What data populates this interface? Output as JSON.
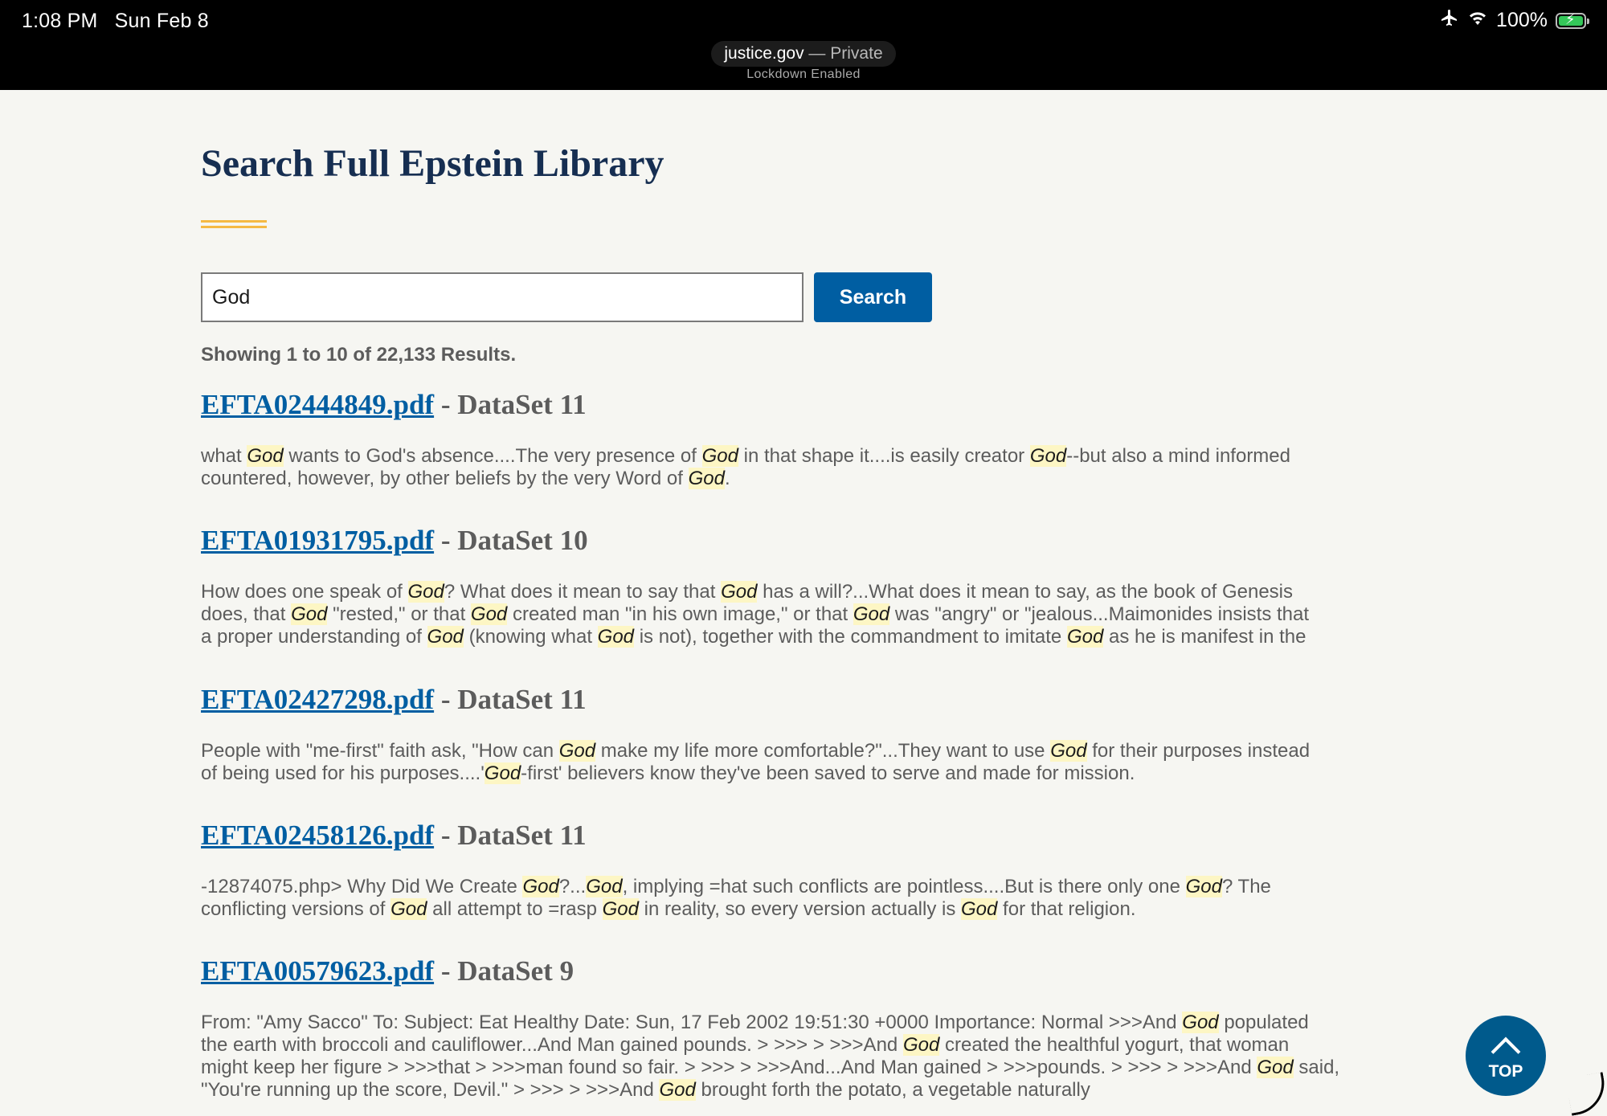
{
  "status_bar": {
    "time": "1:08 PM",
    "date": "Sun Feb 8",
    "battery": "100%",
    "url_domain": "justice.gov",
    "url_mode": " — Private",
    "lockdown": "Lockdown Enabled"
  },
  "page": {
    "title": "Search Full Epstein Library",
    "search_value": "God",
    "search_button": "Search",
    "results_count": "Showing 1 to 10 of 22,133 Results.",
    "top_button": "TOP"
  },
  "results": [
    {
      "file": "EFTA02444849.pdf",
      "dataset": " - DataSet 11",
      "lines": [
        [
          [
            "what ",
            false
          ],
          [
            "God",
            true
          ],
          [
            " wants to God's absence....The very presence of ",
            false
          ],
          [
            "God",
            true
          ],
          [
            " in that shape it....is easily creator ",
            false
          ],
          [
            "God",
            true
          ],
          [
            "--but also a mind informed",
            false
          ]
        ],
        [
          [
            "countered, however, by other beliefs by the very Word of ",
            false
          ],
          [
            "God",
            true
          ],
          [
            ".",
            false
          ]
        ]
      ]
    },
    {
      "file": "EFTA01931795.pdf",
      "dataset": " - DataSet 10",
      "lines": [
        [
          [
            "How does one speak of ",
            false
          ],
          [
            "God",
            true
          ],
          [
            "? What does it mean to say that ",
            false
          ],
          [
            "God",
            true
          ],
          [
            " has a will?...What does it mean to say, as the book of Genesis",
            false
          ]
        ],
        [
          [
            "does, that ",
            false
          ],
          [
            "God",
            true
          ],
          [
            " \"rested,\" or that ",
            false
          ],
          [
            "God",
            true
          ],
          [
            " created man \"in his own image,\" or that ",
            false
          ],
          [
            "God",
            true
          ],
          [
            " was \"angry\" or \"jealous...Maimonides insists that",
            false
          ]
        ],
        [
          [
            "a proper understanding of ",
            false
          ],
          [
            "God",
            true
          ],
          [
            " (knowing what ",
            false
          ],
          [
            "God",
            true
          ],
          [
            " is not), together with the commandment to imitate ",
            false
          ],
          [
            "God",
            true
          ],
          [
            " as he is manifest in the",
            false
          ]
        ]
      ]
    },
    {
      "file": "EFTA02427298.pdf",
      "dataset": " - DataSet 11",
      "lines": [
        [
          [
            "People with \"me-first\" faith ask, \"How can ",
            false
          ],
          [
            "God",
            true
          ],
          [
            " make my life more comfortable?\"...They want to use ",
            false
          ],
          [
            "God",
            true
          ],
          [
            " for their purposes instead",
            false
          ]
        ],
        [
          [
            "of being used for his purposes....'",
            false
          ],
          [
            "God",
            true
          ],
          [
            "-first' believers know they've been saved to serve and made for mission.",
            false
          ]
        ]
      ]
    },
    {
      "file": "EFTA02458126.pdf",
      "dataset": " - DataSet 11",
      "lines": [
        [
          [
            "-12874075.php> Why Did We Create ",
            false
          ],
          [
            "God",
            true
          ],
          [
            "?...",
            false
          ],
          [
            "God",
            true
          ],
          [
            ", implying =hat such conflicts are pointless....But is there only one ",
            false
          ],
          [
            "God",
            true
          ],
          [
            "? The",
            false
          ]
        ],
        [
          [
            "conflicting versions of ",
            false
          ],
          [
            "God",
            true
          ],
          [
            " all attempt to =rasp ",
            false
          ],
          [
            "God",
            true
          ],
          [
            " in reality, so every version actually is ",
            false
          ],
          [
            "God",
            true
          ],
          [
            " for that religion.",
            false
          ]
        ]
      ]
    },
    {
      "file": "EFTA00579623.pdf",
      "dataset": " - DataSet 9",
      "lines": [
        [
          [
            "From: \"Amy Sacco\" To: Subject: Eat Healthy Date: Sun, 17 Feb 2002 19:51:30 +0000 Importance: Normal >>>And ",
            false
          ],
          [
            "God",
            true
          ],
          [
            " populated",
            false
          ]
        ],
        [
          [
            "the earth with broccoli and cauliflower...And Man gained pounds. > >>> > >>>And ",
            false
          ],
          [
            "God",
            true
          ],
          [
            " created the healthful yogurt, that woman",
            false
          ]
        ],
        [
          [
            "might keep her figure > >>>that > >>>man found so fair. > >>> > >>>And...And Man gained > >>>pounds. > >>> > >>>And ",
            false
          ],
          [
            "God",
            true
          ],
          [
            " said,",
            false
          ]
        ],
        [
          [
            "\"You're running up the score, Devil.\" > >>> > >>>And ",
            false
          ],
          [
            "God",
            true
          ],
          [
            " brought forth the potato, a vegetable naturally",
            false
          ]
        ]
      ]
    }
  ]
}
